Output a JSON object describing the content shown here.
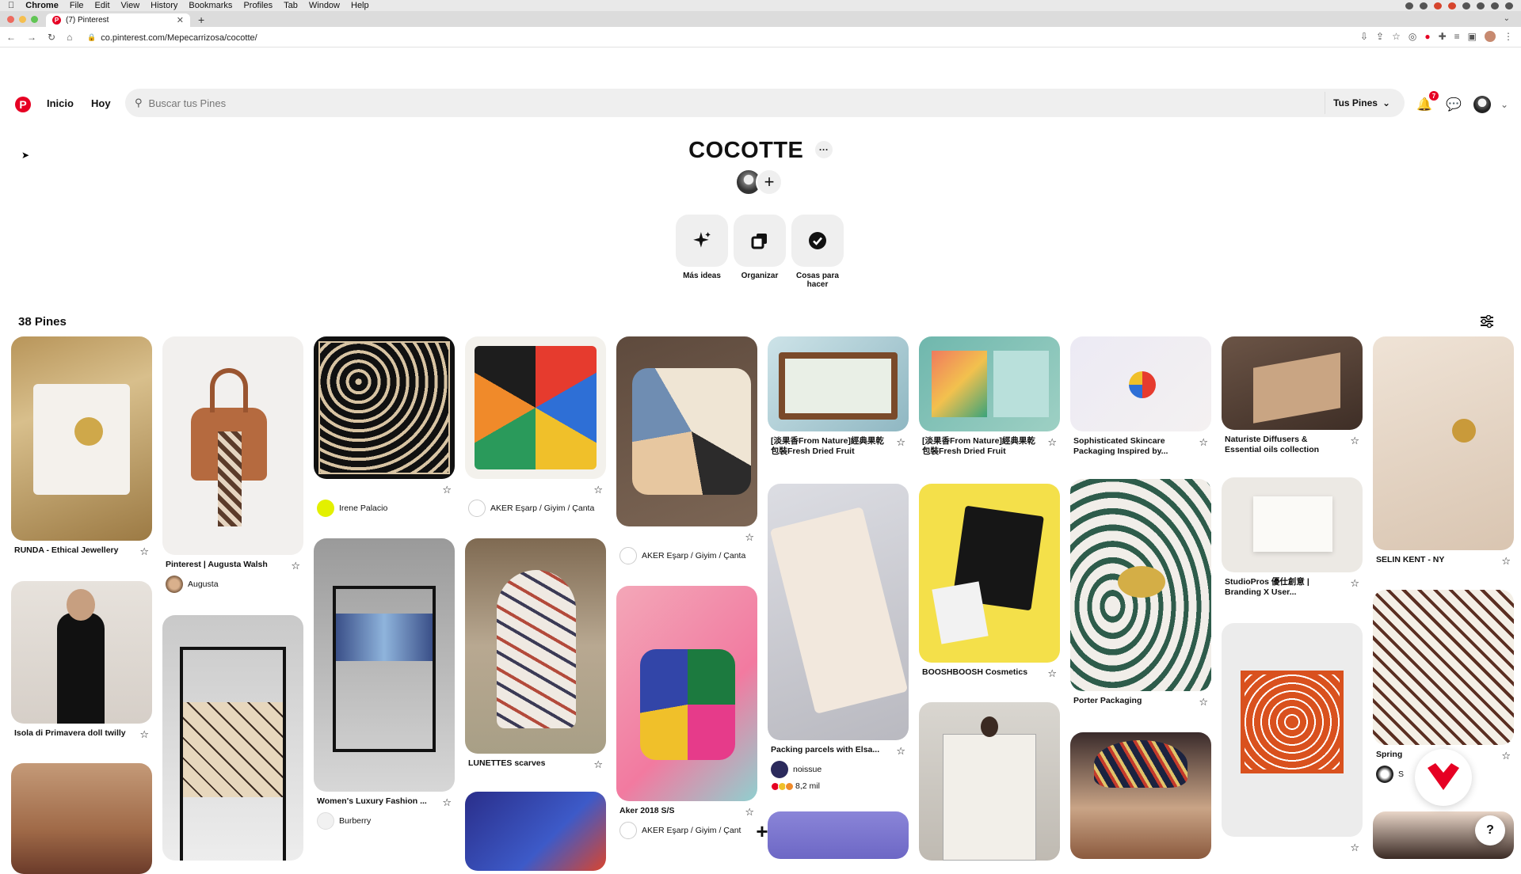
{
  "mac_menu": {
    "apple": "",
    "items": [
      "Chrome",
      "File",
      "Edit",
      "View",
      "History",
      "Bookmarks",
      "Profiles",
      "Tab",
      "Window",
      "Help"
    ]
  },
  "browser": {
    "tab_title": "(7) Pinterest",
    "new_tab": "+",
    "url": "co.pinterest.com/Mepecarrizosa/cocotte/"
  },
  "header": {
    "nav_home": "Inicio",
    "nav_today": "Hoy",
    "search_placeholder": "Buscar tus Pines",
    "your_pins": "Tus Pines",
    "notifications_count": "7"
  },
  "board": {
    "title": "COCOTTE",
    "more": "···",
    "actions": [
      {
        "label": "Más ideas",
        "icon": "sparkle-icon"
      },
      {
        "label": "Organizar",
        "icon": "organize-icon"
      },
      {
        "label": "Cosas para hacer",
        "icon": "checkmark-icon"
      }
    ],
    "pin_count": "38 Pines"
  },
  "pins": {
    "c0": [
      {
        "title": "RUNDA - Ethical Jewellery"
      },
      {
        "title": "Isola di Primavera doll twilly"
      }
    ],
    "c1": [
      {
        "title": "Pinterest | Augusta Walsh",
        "owner": "Augusta"
      }
    ],
    "c2": [
      {
        "owner": "Irene Palacio"
      },
      {
        "title": "Women's Luxury Fashion ...",
        "owner": "Burberry"
      }
    ],
    "c3": [
      {
        "owner": "AKER Eşarp / Giyim / Çanta"
      },
      {
        "title": "LUNETTES scarves"
      }
    ],
    "c4": [
      {
        "owner": "AKER Eşarp / Giyim / Çanta"
      },
      {
        "title": "Aker 2018 S/S",
        "owner": "AKER Eşarp / Giyim / Çant"
      }
    ],
    "c5": [
      {
        "title": "[淡果香From Nature]經典果乾包裝Fresh Dried Fruit"
      },
      {
        "title": "Packing parcels with Elsa...",
        "owner": "noissue",
        "reactions": "8,2  mil"
      }
    ],
    "c6": [
      {
        "title": "[淡果香From Nature]經典果乾包裝Fresh Dried Fruit"
      },
      {
        "title": "BOOSHBOOSH Cosmetics"
      }
    ],
    "c7": [
      {
        "title": "Sophisticated Skincare Packaging Inspired by..."
      },
      {
        "title": "Porter Packaging"
      }
    ],
    "c8": [
      {
        "title": "Naturiste Diffusers & Essential oils collection"
      },
      {
        "title": "StudioPros 優仕創意 | Branding X User..."
      }
    ],
    "c9": [
      {
        "title": "SELIN KENT - NY"
      },
      {
        "title": "Spring",
        "owner": "S"
      }
    ]
  },
  "colors": {
    "brand": "#e60023",
    "chip": "#efefef"
  },
  "floating": {
    "plus": "+",
    "help": "?"
  }
}
